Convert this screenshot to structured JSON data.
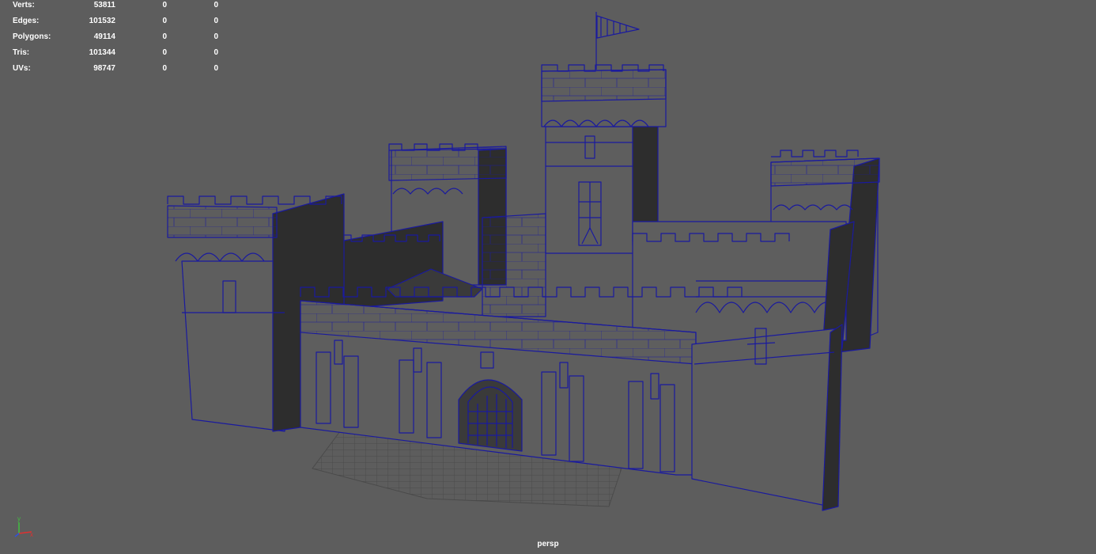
{
  "hud": {
    "rows": [
      {
        "label": "Verts:",
        "v1": "53811",
        "v2": "0",
        "v3": "0"
      },
      {
        "label": "Edges:",
        "v1": "101532",
        "v2": "0",
        "v3": "0"
      },
      {
        "label": "Polygons:",
        "v1": "49114",
        "v2": "0",
        "v3": "0"
      },
      {
        "label": "Tris:",
        "v1": "101344",
        "v2": "0",
        "v3": "0"
      },
      {
        "label": "UVs:",
        "v1": "98747",
        "v2": "0",
        "v3": "0"
      }
    ]
  },
  "viewport": {
    "camera": "persp",
    "background": "#5d5d5d",
    "wire_color": "#1a1a9e",
    "face_color": "#5e5e5e",
    "shadow_color": "#2d2d2d",
    "axis": {
      "y": "y",
      "x": "x",
      "x_color": "#e03030",
      "y_color": "#40c040",
      "z_color": "#3050e0"
    }
  }
}
